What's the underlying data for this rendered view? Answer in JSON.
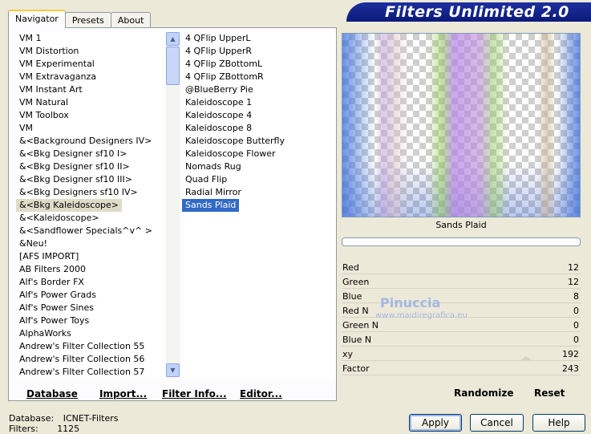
{
  "tabs": [
    {
      "label": "Navigator"
    },
    {
      "label": "Presets"
    },
    {
      "label": "About"
    }
  ],
  "banner_title": "Filters Unlimited 2.0",
  "categories": [
    "VM 1",
    "VM Distortion",
    "VM Experimental",
    "VM Extravaganza",
    "VM Instant Art",
    "VM Natural",
    "VM Toolbox",
    "VM",
    "&<Background Designers IV>",
    "&<Bkg Designer sf10 I>",
    "&<Bkg Designer sf10 II>",
    "&<Bkg Designer sf10 III>",
    "&<Bkg Designers sf10 IV>",
    "&<Bkg Kaleidoscope>",
    "&<Kaleidoscope>",
    "&<Sandflower Specials^v^ >",
    "&Neu!",
    "[AFS IMPORT]",
    "AB Filters 2000",
    "Alf's Border FX",
    "Alf's Power Grads",
    "Alf's Power Sines",
    "Alf's Power Toys",
    "AlphaWorks",
    "Andrew's Filter Collection 55",
    "Andrew's Filter Collection 56",
    "Andrew's Filter Collection 57"
  ],
  "selected_category": "&<Bkg Kaleidoscope>",
  "filters": [
    "4 QFlip UpperL",
    "4 QFlip UpperR",
    "4 QFlip ZBottomL",
    "4 QFlip ZBottomR",
    "@BlueBerry Pie",
    "Kaleidoscope 1",
    "Kaleidoscope 4",
    "Kaleidoscope 8",
    "Kaleidoscope Butterfly",
    "Kaleidoscope Flower",
    "Nomads Rug",
    "Quad Flip",
    "Radial Mirror",
    "Sands Plaid"
  ],
  "selected_filter": "Sands Plaid",
  "buttons": {
    "database": "Database",
    "import": "Import...",
    "filter_info": "Filter Info...",
    "editor": "Editor...",
    "randomize": "Randomize",
    "reset": "Reset",
    "apply": "Apply",
    "cancel": "Cancel",
    "help": "Help"
  },
  "preview_name": "Sands Plaid",
  "params": [
    {
      "label": "Red",
      "value": "12"
    },
    {
      "label": "Green",
      "value": "12"
    },
    {
      "label": "Blue",
      "value": "8"
    },
    {
      "label": "Red N",
      "value": "0"
    },
    {
      "label": "Green N",
      "value": "0"
    },
    {
      "label": "Blue N",
      "value": "0"
    },
    {
      "label": "xy",
      "value": "192"
    },
    {
      "label": "Factor",
      "value": "243"
    }
  ],
  "watermark": {
    "name": "Pinuccia",
    "site": "www.maidiregrafica.eu"
  },
  "status": {
    "database_label": "Database:",
    "database_value": "ICNET-Filters",
    "filters_label": "Filters:",
    "filters_value": "1125"
  }
}
